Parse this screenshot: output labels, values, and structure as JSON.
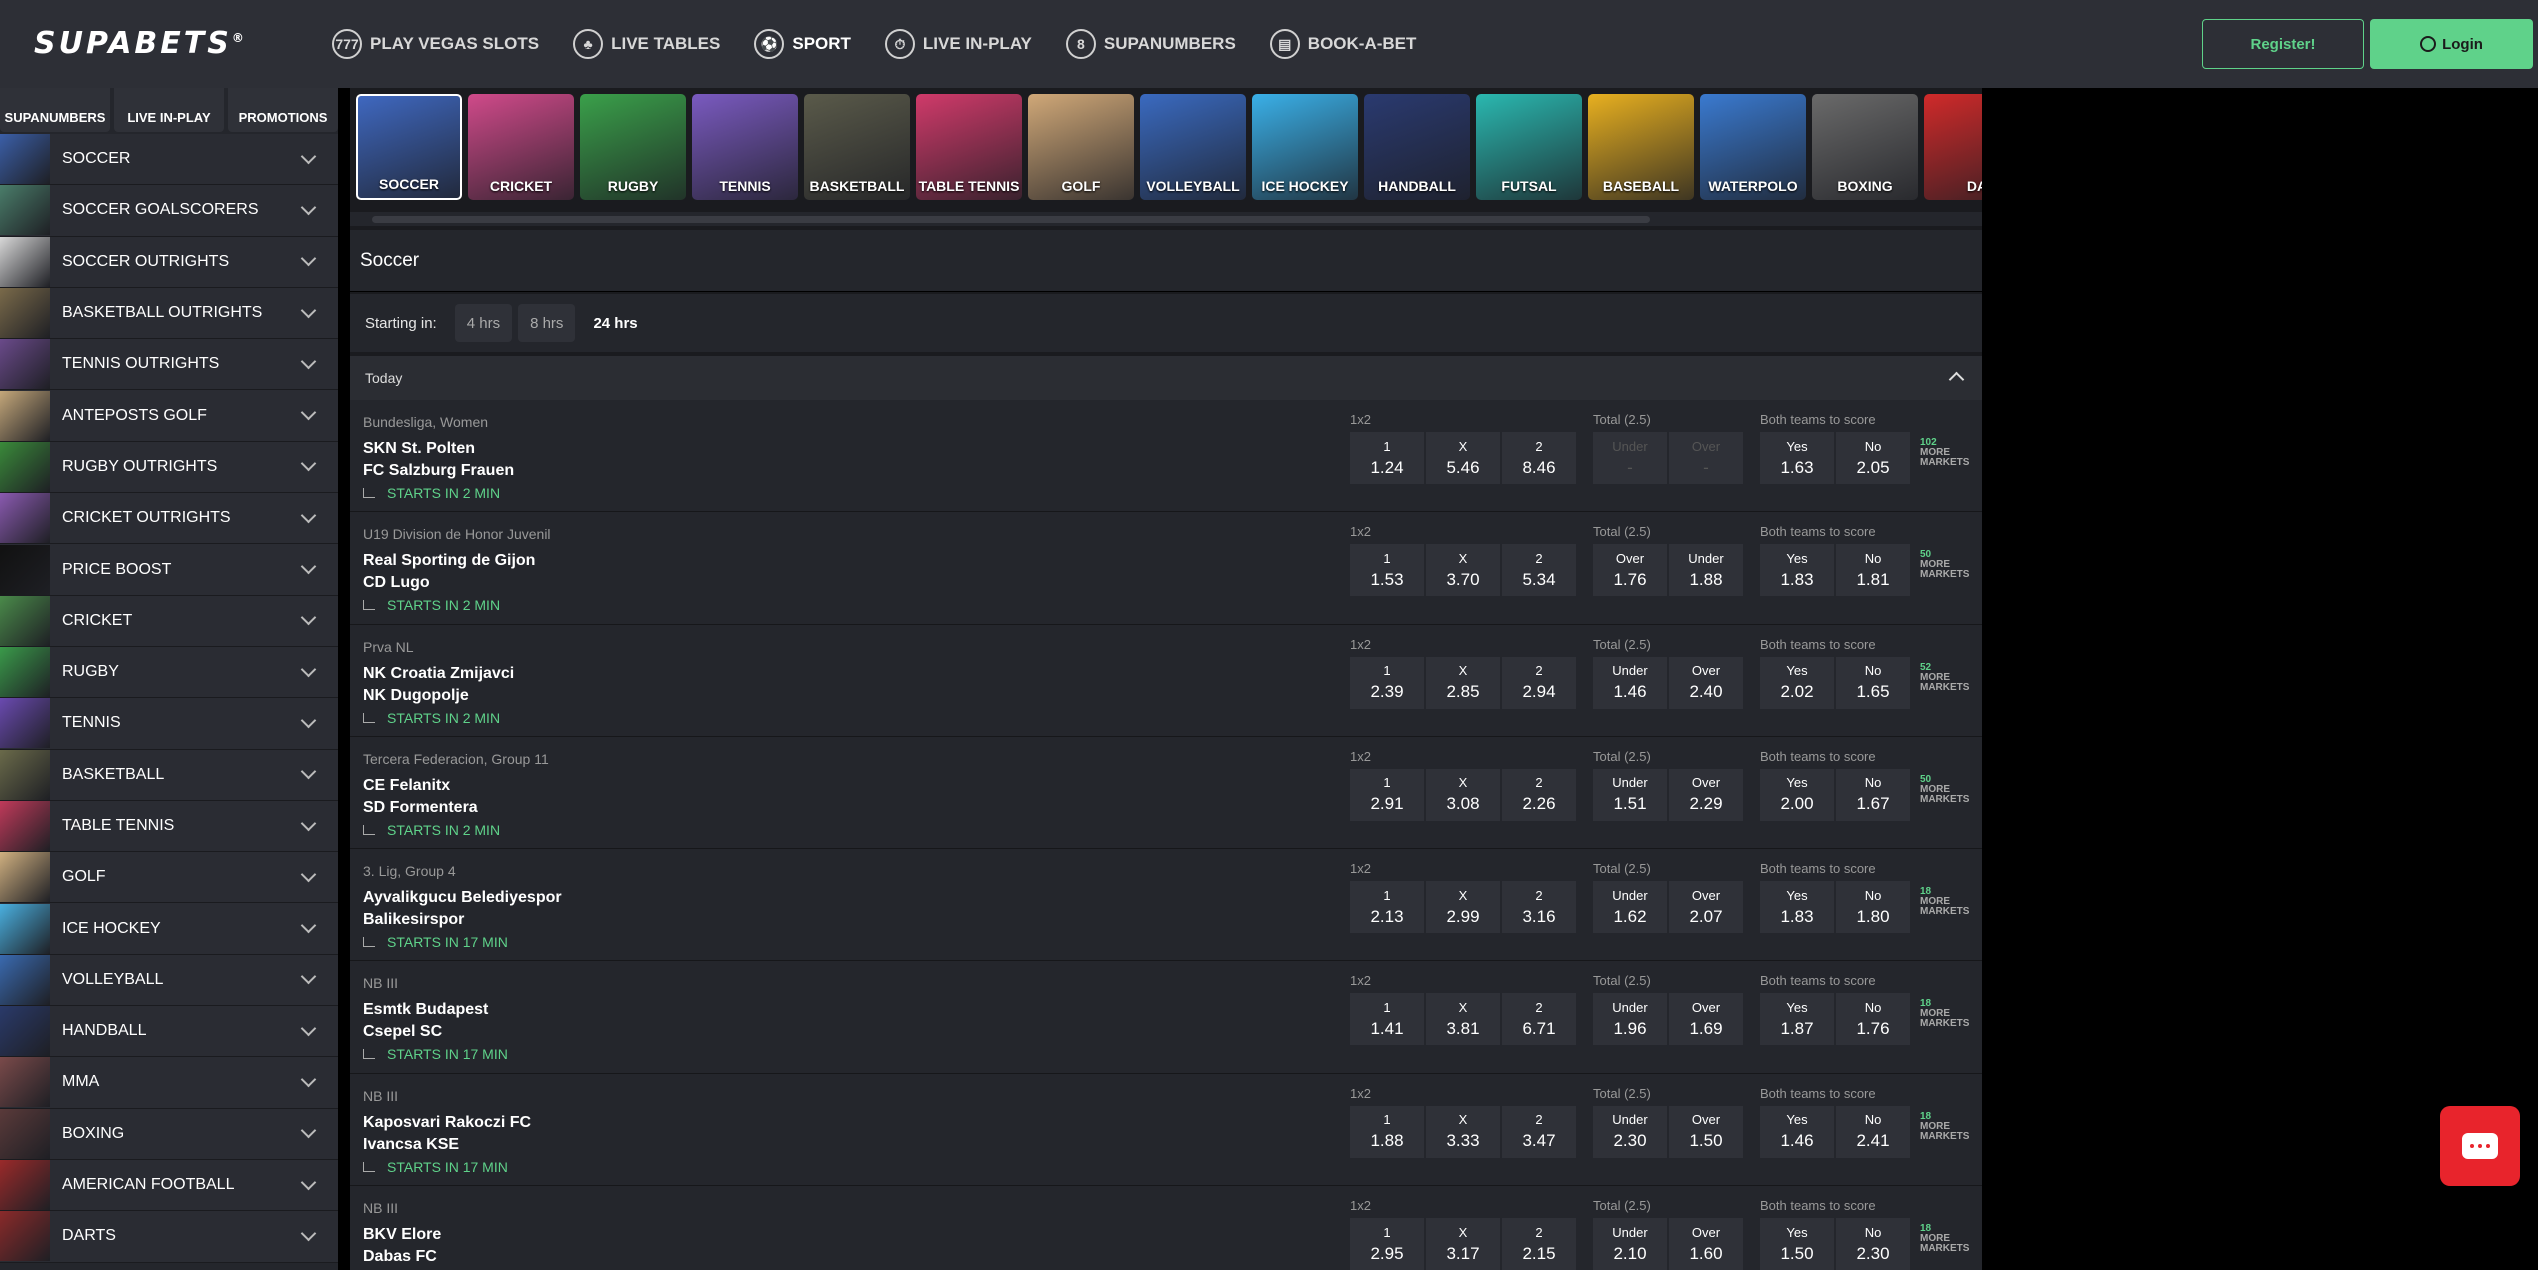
{
  "header": {
    "logo": "SUPABETS",
    "nav": [
      {
        "label": "PLAY VEGAS SLOTS",
        "icon": "slots-icon",
        "glyph": "777"
      },
      {
        "label": "LIVE TABLES",
        "icon": "live-tables-icon",
        "glyph": "♣"
      },
      {
        "label": "SPORT",
        "icon": "soccer-ball-icon",
        "glyph": "⚽"
      },
      {
        "label": "LIVE IN-PLAY",
        "icon": "stopwatch-icon",
        "glyph": "⏱"
      },
      {
        "label": "SUPANUMBERS",
        "icon": "supanumbers-icon",
        "glyph": "8"
      },
      {
        "label": "BOOK-A-BET",
        "icon": "book-a-bet-icon",
        "glyph": "▤"
      }
    ],
    "register": "Register!",
    "login": "Login"
  },
  "sidebar": {
    "quick": [
      "SUPANUMBERS",
      "LIVE IN-PLAY",
      "PROMOTIONS"
    ],
    "items": [
      {
        "label": "SOCCER",
        "color": "#3b5fa8"
      },
      {
        "label": "SOCCER GOALSCORERS",
        "color": "#4a7d6a"
      },
      {
        "label": "SOCCER OUTRIGHTS",
        "color": "#d8d8d8"
      },
      {
        "label": "BASKETBALL OUTRIGHTS",
        "color": "#7a6a4a"
      },
      {
        "label": "TENNIS OUTRIGHTS",
        "color": "#6a4a8a"
      },
      {
        "label": "ANTEPOSTS GOLF",
        "color": "#c4a77a"
      },
      {
        "label": "RUGBY OUTRIGHTS",
        "color": "#3a8a3a"
      },
      {
        "label": "CRICKET OUTRIGHTS",
        "color": "#8a5ab0"
      },
      {
        "label": "PRICE BOOST",
        "color": "#111111"
      },
      {
        "label": "CRICKET",
        "color": "#4a8a4a"
      },
      {
        "label": "RUGBY",
        "color": "#3a9a4a"
      },
      {
        "label": "TENNIS",
        "color": "#6a4ab0"
      },
      {
        "label": "BASKETBALL",
        "color": "#6a6a4a"
      },
      {
        "label": "TABLE TENNIS",
        "color": "#c03a5a"
      },
      {
        "label": "GOLF",
        "color": "#d0b080"
      },
      {
        "label": "ICE HOCKEY",
        "color": "#4ab0e0"
      },
      {
        "label": "VOLLEYBALL",
        "color": "#3a6ab0"
      },
      {
        "label": "HANDBALL",
        "color": "#2a3a6a"
      },
      {
        "label": "MMA",
        "color": "#7a4a4a"
      },
      {
        "label": "BOXING",
        "color": "#5a3a3a"
      },
      {
        "label": "AMERICAN FOOTBALL",
        "color": "#9a2a2a"
      },
      {
        "label": "DARTS",
        "color": "#8a2a2a"
      }
    ]
  },
  "sports": [
    {
      "label": "SOCCER",
      "color": "#3f68c0",
      "active": true
    },
    {
      "label": "CRICKET",
      "color": "#d04a8a"
    },
    {
      "label": "RUGBY",
      "color": "#3aa04a"
    },
    {
      "label": "TENNIS",
      "color": "#7a5ac0"
    },
    {
      "label": "BASKETBALL",
      "color": "#5a5a4a"
    },
    {
      "label": "TABLE TENNIS",
      "color": "#d03a6a"
    },
    {
      "label": "GOLF",
      "color": "#d0a878"
    },
    {
      "label": "VOLLEYBALL",
      "color": "#3a6ac0"
    },
    {
      "label": "ICE HOCKEY",
      "color": "#3ab0e8"
    },
    {
      "label": "HANDBALL",
      "color": "#2a3a70"
    },
    {
      "label": "FUTSAL",
      "color": "#2ab8b0"
    },
    {
      "label": "BASEBALL",
      "color": "#e8b020"
    },
    {
      "label": "WATERPOLO",
      "color": "#3a7ad0"
    },
    {
      "label": "BOXING",
      "color": "#6a6a6a"
    },
    {
      "label": "DA",
      "color": "#d02a2a"
    }
  ],
  "main": {
    "title": "Soccer",
    "starting_in_label": "Starting in:",
    "filters": [
      "4 hrs",
      "8 hrs",
      "24 hrs"
    ],
    "section": "Today",
    "market_titles": [
      "1x2",
      "Total (2.5)",
      "Both teams to score"
    ],
    "more_label": "MORE MARKETS"
  },
  "events": [
    {
      "league": "Bundesliga, Women",
      "home": "SKN St. Polten",
      "away": "FC Salzburg Frauen",
      "starts": "STARTS IN 2 MIN",
      "x12": [
        [
          "1",
          "1.24"
        ],
        [
          "X",
          "5.46"
        ],
        [
          "2",
          "8.46"
        ]
      ],
      "total": [
        [
          "Under",
          "-"
        ],
        [
          "Over",
          "-"
        ]
      ],
      "total_disabled": true,
      "btts": [
        [
          "Yes",
          "1.63"
        ],
        [
          "No",
          "2.05"
        ]
      ],
      "more": "102"
    },
    {
      "league": "U19 Division de Honor Juvenil",
      "home": "Real Sporting de Gijon",
      "away": "CD Lugo",
      "starts": "STARTS IN 2 MIN",
      "x12": [
        [
          "1",
          "1.53"
        ],
        [
          "X",
          "3.70"
        ],
        [
          "2",
          "5.34"
        ]
      ],
      "total": [
        [
          "Over",
          "1.76"
        ],
        [
          "Under",
          "1.88"
        ]
      ],
      "btts": [
        [
          "Yes",
          "1.83"
        ],
        [
          "No",
          "1.81"
        ]
      ],
      "more": "50"
    },
    {
      "league": "Prva NL",
      "home": "NK Croatia Zmijavci",
      "away": "NK Dugopolje",
      "starts": "STARTS IN 2 MIN",
      "x12": [
        [
          "1",
          "2.39"
        ],
        [
          "X",
          "2.85"
        ],
        [
          "2",
          "2.94"
        ]
      ],
      "total": [
        [
          "Under",
          "1.46"
        ],
        [
          "Over",
          "2.40"
        ]
      ],
      "btts": [
        [
          "Yes",
          "2.02"
        ],
        [
          "No",
          "1.65"
        ]
      ],
      "more": "52"
    },
    {
      "league": "Tercera Federacion, Group 11",
      "home": "CE Felanitx",
      "away": "SD Formentera",
      "starts": "STARTS IN 2 MIN",
      "x12": [
        [
          "1",
          "2.91"
        ],
        [
          "X",
          "3.08"
        ],
        [
          "2",
          "2.26"
        ]
      ],
      "total": [
        [
          "Under",
          "1.51"
        ],
        [
          "Over",
          "2.29"
        ]
      ],
      "btts": [
        [
          "Yes",
          "2.00"
        ],
        [
          "No",
          "1.67"
        ]
      ],
      "more": "50"
    },
    {
      "league": "3. Lig, Group 4",
      "home": "Ayvalikgucu Belediyespor",
      "away": "Balikesirspor",
      "starts": "STARTS IN 17 MIN",
      "x12": [
        [
          "1",
          "2.13"
        ],
        [
          "X",
          "2.99"
        ],
        [
          "2",
          "3.16"
        ]
      ],
      "total": [
        [
          "Under",
          "1.62"
        ],
        [
          "Over",
          "2.07"
        ]
      ],
      "btts": [
        [
          "Yes",
          "1.83"
        ],
        [
          "No",
          "1.80"
        ]
      ],
      "more": "18"
    },
    {
      "league": "NB III",
      "home": "Esmtk Budapest",
      "away": "Csepel SC",
      "starts": "STARTS IN 17 MIN",
      "x12": [
        [
          "1",
          "1.41"
        ],
        [
          "X",
          "3.81"
        ],
        [
          "2",
          "6.71"
        ]
      ],
      "total": [
        [
          "Under",
          "1.96"
        ],
        [
          "Over",
          "1.69"
        ]
      ],
      "btts": [
        [
          "Yes",
          "1.87"
        ],
        [
          "No",
          "1.76"
        ]
      ],
      "more": "18"
    },
    {
      "league": "NB III",
      "home": "Kaposvari Rakoczi FC",
      "away": "Ivancsa KSE",
      "starts": "STARTS IN 17 MIN",
      "x12": [
        [
          "1",
          "1.88"
        ],
        [
          "X",
          "3.33"
        ],
        [
          "2",
          "3.47"
        ]
      ],
      "total": [
        [
          "Under",
          "2.30"
        ],
        [
          "Over",
          "1.50"
        ]
      ],
      "btts": [
        [
          "Yes",
          "1.46"
        ],
        [
          "No",
          "2.41"
        ]
      ],
      "more": "18"
    },
    {
      "league": "NB III",
      "home": "BKV Elore",
      "away": "Dabas FC",
      "starts": "",
      "x12": [
        [
          "1",
          "2.95"
        ],
        [
          "X",
          "3.17"
        ],
        [
          "2",
          "2.15"
        ]
      ],
      "total": [
        [
          "Under",
          "2.10"
        ],
        [
          "Over",
          "1.60"
        ]
      ],
      "btts": [
        [
          "Yes",
          "1.50"
        ],
        [
          "No",
          "2.30"
        ]
      ],
      "more": "18"
    }
  ]
}
